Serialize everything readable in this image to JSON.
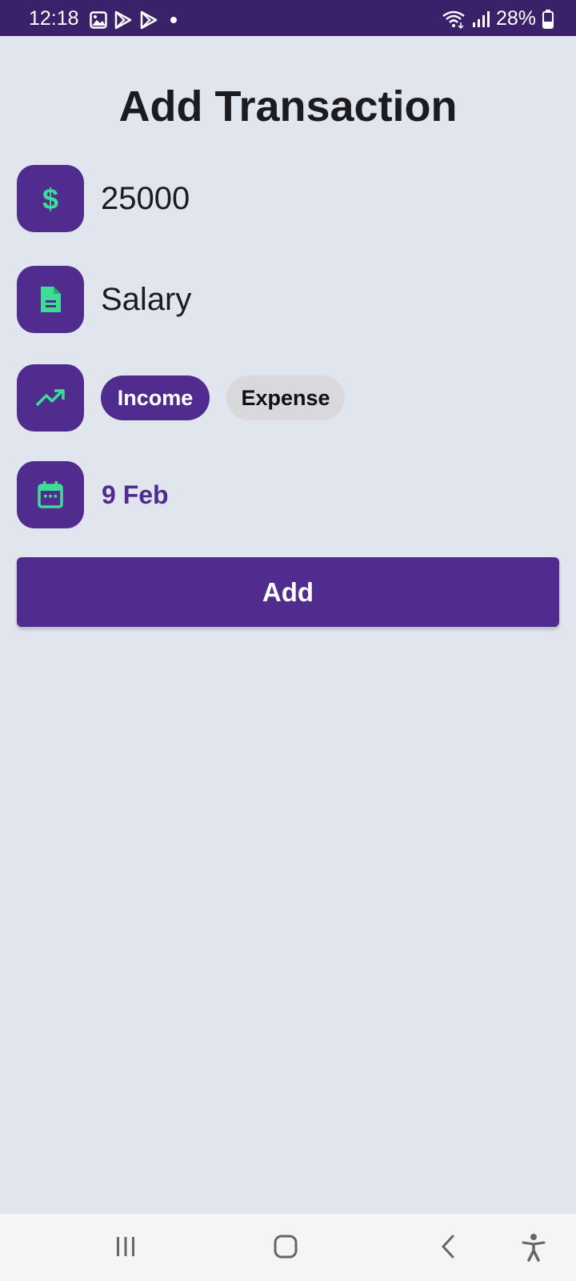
{
  "status_bar": {
    "time": "12:18",
    "battery": "28%",
    "notification_icons": [
      "gallery-icon",
      "play-store-icon",
      "play-store-icon",
      "dot-icon"
    ],
    "system_icons": [
      "wifi-icon",
      "signal-icon",
      "battery-icon"
    ]
  },
  "page": {
    "title": "Add Transaction"
  },
  "form": {
    "amount": {
      "value": "25000",
      "icon": "dollar-icon"
    },
    "description": {
      "value": "Salary",
      "icon": "document-icon"
    },
    "type": {
      "icon": "trending-up-icon",
      "options": [
        "Income",
        "Expense"
      ],
      "selected": "Income"
    },
    "date": {
      "value": "9 Feb",
      "icon": "calendar-icon"
    },
    "submit_label": "Add"
  },
  "colors": {
    "primary": "#512c8f",
    "accent_icon": "#3ddc97",
    "background": "#e1e5ee",
    "status_bar": "#3a2169",
    "chip_unselected": "#d9d9dd"
  },
  "nav_bar": {
    "buttons": [
      "recents-icon",
      "home-icon",
      "back-icon",
      "accessibility-icon"
    ]
  }
}
